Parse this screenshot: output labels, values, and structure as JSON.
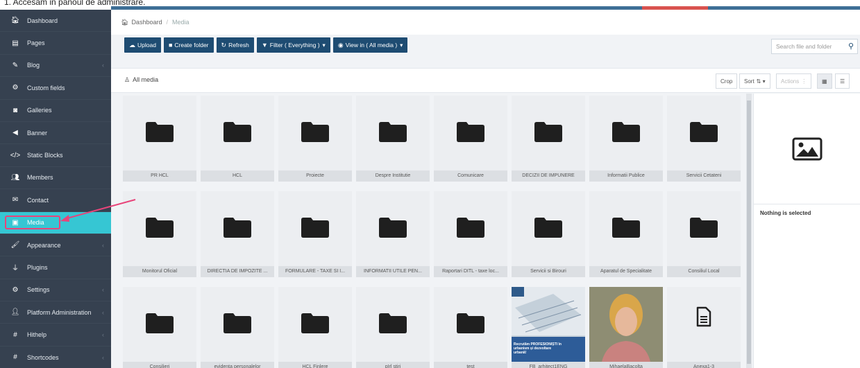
{
  "topbar": {
    "partial_text": "1. Accesam in panoul de administrare."
  },
  "sidebar": {
    "items": [
      {
        "label": "Dashboard",
        "icon": "home-icon",
        "has_chevron": false
      },
      {
        "label": "Pages",
        "icon": "file-icon",
        "has_chevron": false
      },
      {
        "label": "Blog",
        "icon": "edit-icon",
        "has_chevron": true
      },
      {
        "label": "Custom fields",
        "icon": "cogs-icon",
        "has_chevron": false
      },
      {
        "label": "Galleries",
        "icon": "camera-icon",
        "has_chevron": false
      },
      {
        "label": "Banner",
        "icon": "bullhorn-icon",
        "has_chevron": false
      },
      {
        "label": "Static Blocks",
        "icon": "code-icon",
        "has_chevron": false
      },
      {
        "label": "Members",
        "icon": "users-icon",
        "has_chevron": false
      },
      {
        "label": "Contact",
        "icon": "envelope-icon",
        "has_chevron": false
      },
      {
        "label": "Media",
        "icon": "images-icon",
        "has_chevron": false,
        "active": true
      },
      {
        "label": "Appearance",
        "icon": "brush-icon",
        "has_chevron": true
      },
      {
        "label": "Plugins",
        "icon": "plug-icon",
        "has_chevron": false
      },
      {
        "label": "Settings",
        "icon": "settings-icon",
        "has_chevron": true
      },
      {
        "label": "Platform Administration",
        "icon": "user-secret-icon",
        "has_chevron": true
      },
      {
        "label": "Hithelp",
        "icon": "hash-icon",
        "has_chevron": true
      },
      {
        "label": "Shortcodes",
        "icon": "hash-icon",
        "has_chevron": true
      }
    ]
  },
  "breadcrumb": {
    "home": "Dashboard",
    "current": "Media"
  },
  "toolbar": {
    "upload": "Upload",
    "create_folder": "Create folder",
    "refresh": "Refresh",
    "filter": "Filter ( Everything )",
    "view_in": "View in ( All media )"
  },
  "search": {
    "placeholder": "Search file and folder"
  },
  "panel": {
    "title": "All media",
    "crop": "Crop",
    "sort": "Sort",
    "actions": "Actions"
  },
  "details": {
    "nothing_selected": "Nothing is selected"
  },
  "items": [
    "PR HCL",
    "HCL",
    "Proiecte",
    "Despre Institutie",
    "Comunicare",
    "DECIZII DE IMPUNERE",
    "Informatii Publice",
    "Servicii Cetateni",
    "Monitorul Oficial",
    "DIRECTIA DE IMPOZITE ...",
    "FORMULARE - TAXE SI I...",
    "INFORMATII UTILE PEN...",
    "Raportari DITL - taxe loc...",
    "Servicii si Birouri",
    "Aparatul de Specialitate",
    "Consiliul Local",
    "Consilieri",
    "evidenta personalelor",
    "HCL Finlere",
    "pIrl stiri",
    "test",
    "FB_arhitect1ENG",
    "MihaelaBacolta",
    "Anexa1-3"
  ],
  "image_overlay_text": "Recrutăm PROFESIONIȘTI în urbanism și dezvoltare urbană!"
}
